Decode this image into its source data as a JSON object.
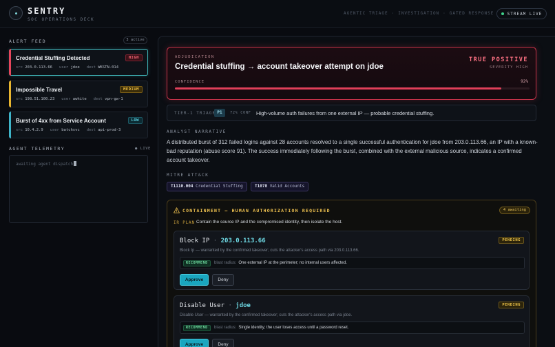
{
  "brand": {
    "title": "SENTRY",
    "subtitle": "SOC OPERATIONS DECK"
  },
  "header_nav": [
    "AGENTIC TRIAGE",
    "INVESTIGATION",
    "GATED RESPONSE"
  ],
  "header_nav_sep": "·",
  "stream_label": "STREAM LIVE",
  "colors": {
    "accent": "#1aa6bf",
    "high": "#ff6a7a",
    "medium": "#f5c443",
    "low": "#5fd8e8",
    "live": "#3fd18b"
  },
  "alert_feed": {
    "label": "ALERT FEED",
    "count_label": "3 active",
    "alerts": [
      {
        "title": "Credential Stuffing Detected",
        "severity": "HIGH",
        "src_label": "src",
        "src": "203.0.113.66",
        "user_label": "user",
        "user": "jdoe",
        "dest_label": "dest",
        "dest": "WKSTN-014"
      },
      {
        "title": "Impossible Travel",
        "severity": "MEDIUM",
        "src_label": "src",
        "src": "198.51.100.23",
        "user_label": "user",
        "user": "awhite",
        "dest_label": "dest",
        "dest": "vpn-gw-1"
      },
      {
        "title": "Burst of 4xx from Service Account",
        "severity": "LOW",
        "src_label": "src",
        "src": "10.4.2.9",
        "user_label": "user",
        "user": "batchsvc",
        "dest_label": "dest",
        "dest": "api-prod-3"
      }
    ]
  },
  "telemetry": {
    "label": "AGENT TELEMETRY",
    "live_label": "● LIVE",
    "line": "awaiting agent dispatch"
  },
  "adjudication": {
    "label": "ADJUDICATION",
    "title": "Credential stuffing → account takeover attempt on jdoe",
    "verdict": "TRUE POSITIVE",
    "severity_label": "SEVERITY HIGH",
    "confidence_label": "CONFIDENCE",
    "confidence_text": "92%",
    "confidence": 0.92
  },
  "triage": {
    "label": "TIER-1 TRIAGE",
    "priority": "P1",
    "conf": "72% CONF",
    "summary": "High-volume auth failures from one external IP — probable credential stuffing."
  },
  "narrative": {
    "label": "ANALYST NARRATIVE",
    "text": "A distributed burst of 312 failed logins against 28 accounts resolved to a single successful authentication for jdoe from 203.0.113.66, an IP with a known-bad reputation (abuse score 91). The success immediately following the burst, combined with the external malicious source, indicates a confirmed account takeover."
  },
  "mitre": {
    "label": "MITRE ATT&CK",
    "techniques": [
      {
        "id": "T1110.004",
        "name": "Credential Stuffing"
      },
      {
        "id": "T1078",
        "name": "Valid Accounts"
      }
    ]
  },
  "containment": {
    "title": "CONTAINMENT — HUMAN AUTHORIZATION REQUIRED",
    "awaiting": "4 awaiting",
    "ir_plan_label": "IR PLAN",
    "ir_plan_text": "Contain the source IP and the compromised identity, then isolate the host.",
    "actions": [
      {
        "name": "Block IP",
        "sep": "·",
        "target": "203.0.113.66",
        "status": "PENDING",
        "desc": "Block Ip — warranted by the confirmed takeover; cuts the attacker's access path via 203.0.113.66.",
        "rec_badge": "RECOMMEND",
        "blast_label": "blast radius:",
        "blast": "One external IP at the perimeter; no internal users affected.",
        "approve": "Approve",
        "deny": "Deny"
      },
      {
        "name": "Disable User",
        "sep": "·",
        "target": "jdoe",
        "status": "PENDING",
        "desc": "Disable User — warranted by the confirmed takeover; cuts the attacker's access path via jdoe.",
        "rec_badge": "RECOMMEND",
        "blast_label": "blast radius:",
        "blast": "Single identity; the user loses access until a password reset.",
        "approve": "Approve",
        "deny": "Deny"
      }
    ]
  }
}
